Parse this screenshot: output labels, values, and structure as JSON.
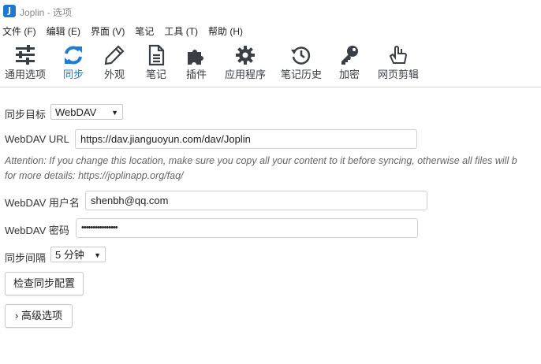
{
  "window": {
    "title": "Joplin - 选项"
  },
  "menu": [
    "文件 (F)",
    "编辑 (E)",
    "界面 (V)",
    "笔记",
    "工具 (T)",
    "帮助 (H)"
  ],
  "toolbar": {
    "items": [
      {
        "label": "通用选项",
        "icon": "sliders-icon"
      },
      {
        "label": "同步",
        "icon": "sync-icon",
        "active": true
      },
      {
        "label": "外观",
        "icon": "pencil-icon"
      },
      {
        "label": "笔记",
        "icon": "note-icon"
      },
      {
        "label": "插件",
        "icon": "puzzle-icon"
      },
      {
        "label": "应用程序",
        "icon": "gear-icon"
      },
      {
        "label": "笔记历史",
        "icon": "history-icon"
      },
      {
        "label": "加密",
        "icon": "key-icon"
      },
      {
        "label": "网页剪辑",
        "icon": "hand-icon"
      }
    ]
  },
  "sync": {
    "target_label": "同步目标",
    "target_value": "WebDAV",
    "url_label": "WebDAV URL",
    "url_value": "https://dav.jianguoyun.com/dav/Joplin",
    "note_line1": "Attention: If you change this location, make sure you copy all your content to it before syncing, otherwise all files will b",
    "note_line2": "for more details: https://joplinapp.org/faq/",
    "username_label": "WebDAV 用户名",
    "username_value": "shenbh@qq.com",
    "password_label": "WebDAV 密码",
    "password_value": "••••••••••••••••",
    "interval_label": "同步间隔",
    "interval_value": "5 分钟",
    "check_button": "检查同步配置",
    "advanced_button": "› 高级选项"
  },
  "colors": {
    "accent": "#1e7bd6",
    "icon_gray": "#3a3f45"
  }
}
